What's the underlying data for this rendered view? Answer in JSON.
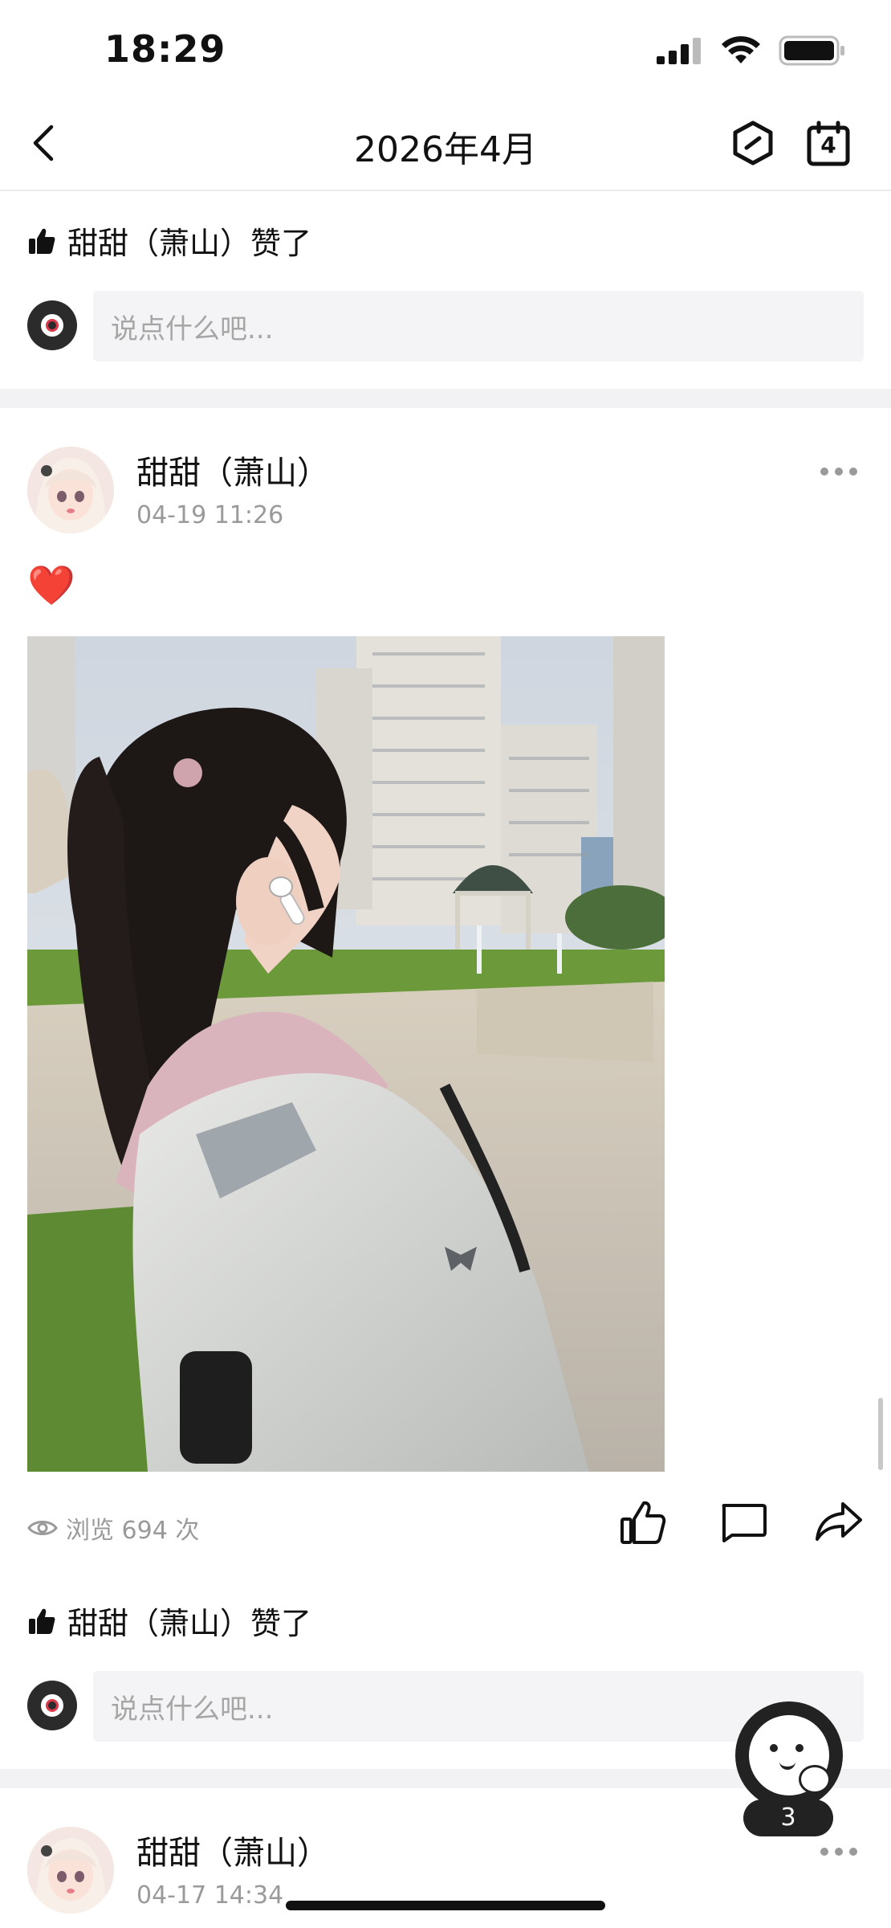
{
  "status_bar": {
    "time": "18:29"
  },
  "header": {
    "title": "2026年4月",
    "calendar_day": "4"
  },
  "posts": [
    {
      "liked_text": "甜甜（萧山）赞了",
      "comment_placeholder": "说点什么吧..."
    },
    {
      "author": "甜甜（萧山）",
      "timestamp": "04-19 11:26",
      "content": "❤️",
      "views_text": "浏览 694 次",
      "liked_text": "甜甜（萧山）赞了",
      "comment_placeholder": "说点什么吧..."
    },
    {
      "author": "甜甜（萧山）",
      "timestamp": "04-17 14:34"
    }
  ],
  "fab": {
    "badge": "3"
  },
  "colors": {
    "divider": "#f2f2f4",
    "muted_text": "#9a9a9a",
    "input_bg": "#f4f4f6"
  }
}
